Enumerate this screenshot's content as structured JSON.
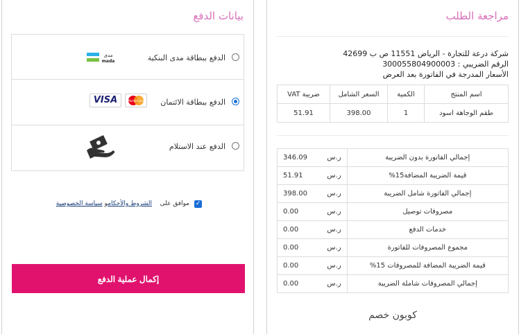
{
  "payment": {
    "title": "بيانات الدفع",
    "methods": [
      {
        "label": "الدفع ببطاقة مدى البنكية",
        "selected": false,
        "logo_top": "مدى",
        "logo_bottom": "mada"
      },
      {
        "label": "الدفع ببطاقة الائتمان",
        "selected": true,
        "logo_visa": "VISA",
        "logo_mc": "MasterCard"
      },
      {
        "label": "الدفع عند الاستلام",
        "selected": false
      }
    ],
    "terms": {
      "checked": true,
      "prefix": "موافق على",
      "link1": "الشروط والأحكام",
      "joiner": "و",
      "link2": "سياسة الخصوصية"
    },
    "pay_button": "إكمال عملية الدفع"
  },
  "order": {
    "title": "مراجعة الطلب",
    "address_lines": [
      "شركة درعة للتجارة - الرياض 11551 ص ب 42699",
      "الرقم الضريبي : 300055804900003",
      "الأسعار المدرجة في الفاتورة بعد العرض"
    ],
    "items_headers": [
      "اسم المنتج",
      "الكمية",
      "السعر الشامل",
      "ضريبة VAT"
    ],
    "items_rows": [
      [
        "طقم الوجاهة اسود",
        "1",
        "398.00",
        "51.91"
      ]
    ],
    "currency": "ر.س",
    "totals": [
      {
        "label": "إجمالي الفاتورة بدون الضريبة",
        "value": "346.09"
      },
      {
        "label": "قيمة الضريبة المضافة15%",
        "value": "51.91"
      },
      {
        "label": "إجمالي الفاتورة شامل الضريبة",
        "value": "398.00"
      },
      {
        "label": "مصروفات توصيل",
        "value": "0.00"
      },
      {
        "label": "خدمات الدفع",
        "value": "0.00"
      },
      {
        "label": "مجموع المصروفات للفاتورة",
        "value": "0.00"
      },
      {
        "label": "قيمة الضريبة المضافة للمصروفات 15%",
        "value": "0.00"
      },
      {
        "label": "إجمالي المصروفات شاملة الضريبة",
        "value": "0.00"
      }
    ],
    "coupon": "كوبون خصم"
  },
  "colors": {
    "accent": "#d86fb9",
    "button": "#e0126e",
    "radio": "#1a6fd6"
  }
}
